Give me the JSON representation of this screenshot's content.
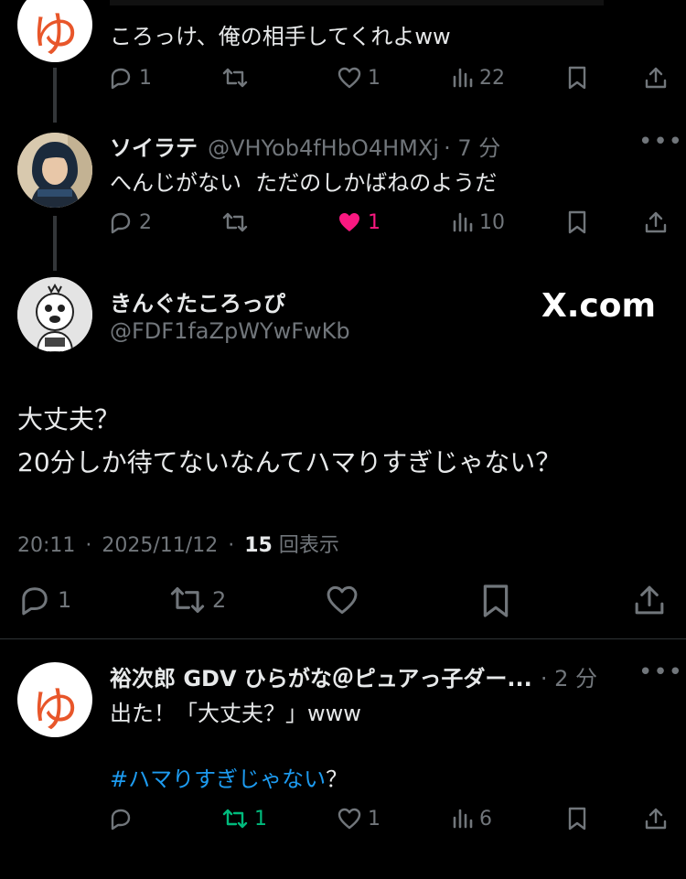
{
  "tweet1": {
    "body": "ころっけ、俺の相手してくれよww",
    "stats": {
      "replies": "1",
      "reposts": "",
      "likes": "1",
      "views": "22"
    },
    "avatar_char": "ゆ"
  },
  "tweet2": {
    "name": "ソイラテ",
    "handle": "@VHYob4fHbO4HMXj",
    "time": "· 7 分",
    "body": "へんじがない  ただのしかばねのようだ",
    "stats": {
      "replies": "2",
      "reposts": "",
      "likes": "1",
      "views": "10"
    }
  },
  "main_tweet": {
    "name": "きんぐたころっぴ",
    "handle": "@FDF1faZpWYwFwKb",
    "watermark": "X.com",
    "line1": "大丈夫？",
    "line2": "20分しか待てないなんてハマりすぎじゃない？",
    "time": "20:11",
    "date": "2025/11/12",
    "view_count": "15",
    "view_label": "回表示",
    "sep": "·",
    "stats": {
      "replies": "1",
      "reposts": "2"
    }
  },
  "reply": {
    "name": "裕次郎 GDV ひらがな＠ピュアっ子ダー...",
    "time": "· 2 分",
    "body": "出た！「大丈夫？」www",
    "hashtag": "#ハマりすぎじゃない",
    "hashtag_suffix": "？",
    "avatar_char": "ゆ",
    "stats": {
      "replies": "",
      "reposts": "1",
      "likes": "1",
      "views": "6"
    }
  },
  "colors": {
    "like_active": "#f91880",
    "repost_active": "#00ba7c",
    "link": "#1d9bf0",
    "muted": "#71767b"
  }
}
